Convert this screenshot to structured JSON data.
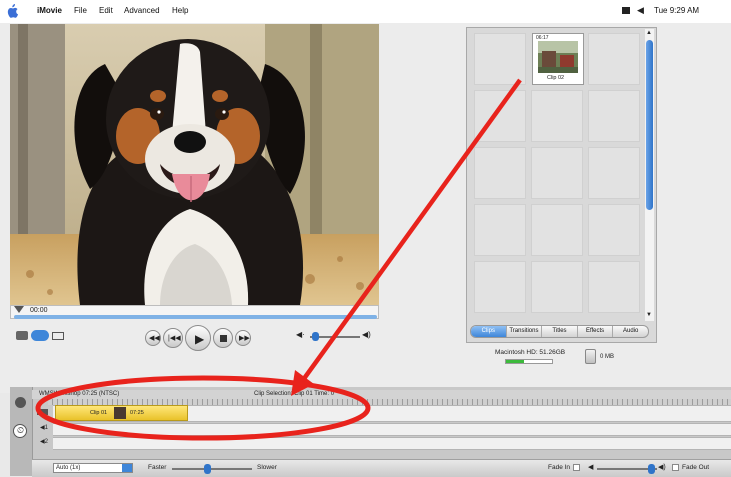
{
  "menubar": {
    "app_name": "iMovie",
    "menus": [
      "File",
      "Edit",
      "Advanced",
      "Help"
    ],
    "clock": "Tue 9:29 AM"
  },
  "viewer": {
    "timecode": "00:00"
  },
  "shelf": {
    "clip_timecode": "06:17",
    "clip_label": "Clip 02",
    "tabs": [
      "Clips",
      "Transitions",
      "Titles",
      "Effects",
      "Audio"
    ],
    "active_tab": "Clips",
    "disk_info": "Macintosh HD: 51.26GB",
    "trash_size": "0 MB"
  },
  "timeline": {
    "project_info": "WMSWorkshop 07:25 (NTSC)",
    "selection_info": "Clip Selection: Clip 01 Time: 0",
    "clip_name": "Clip 01",
    "clip_duration": "07:25",
    "track_labels": [
      "1",
      "2"
    ],
    "speed_select": "Auto (1x)",
    "faster_label": "Faster",
    "slower_label": "Slower",
    "fade_in_label": "Fade In",
    "fade_out_label": "Fade Out"
  },
  "colors": {
    "annotation_red": "#e8231c",
    "selection_blue": "#3e86d9",
    "clip_yellow": "#f2d24a"
  }
}
